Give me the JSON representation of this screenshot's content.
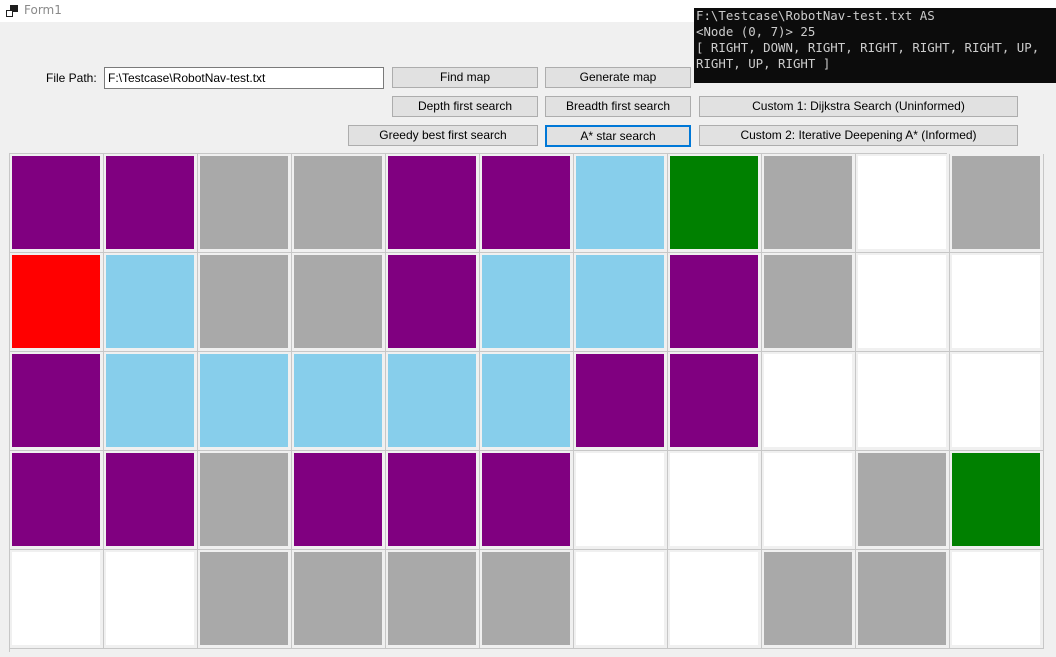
{
  "window": {
    "title": "Form1",
    "icon": "app-window-icon"
  },
  "form": {
    "file_path_label": "File Path:",
    "file_path_value": "F:\\Testcase\\RobotNav-test.txt"
  },
  "buttons": {
    "find_map": "Find map",
    "generate_map": "Generate map",
    "depth_first": "Depth first search",
    "breadth_first": "Breadth first search",
    "custom1": "Custom 1: Dijkstra Search (Uninformed)",
    "greedy": "Greedy best first search",
    "astar": "A* star search",
    "custom2": "Custom 2: Iterative Deepening A* (Informed)"
  },
  "console": {
    "lines": [
      "F:\\Testcase\\RobotNav-test.txt AS",
      "<Node (0, 7)> 25",
      "[ RIGHT, DOWN, RIGHT, RIGHT, RIGHT, RIGHT, UP,",
      "RIGHT, UP, RIGHT ]"
    ]
  },
  "colors": {
    "P": "#800080",
    "G": "#a9a9a9",
    "B": "#87ceeb",
    "R": "#ff0000",
    "E": "#008000",
    "W": "#ffffff"
  },
  "legend_semantics": {
    "P": "explored",
    "G": "wall",
    "B": "path",
    "R": "start",
    "E": "goal",
    "W": "empty"
  },
  "grid": {
    "rows": [
      [
        "P",
        "P",
        "G",
        "G",
        "P",
        "P",
        "B",
        "E",
        "G",
        "W",
        "G"
      ],
      [
        "R",
        "B",
        "G",
        "G",
        "P",
        "B",
        "B",
        "P",
        "G",
        "W",
        "W"
      ],
      [
        "P",
        "B",
        "B",
        "B",
        "B",
        "B",
        "P",
        "P",
        "W",
        "W",
        "W"
      ],
      [
        "P",
        "P",
        "G",
        "P",
        "P",
        "P",
        "W",
        "W",
        "W",
        "G",
        "E"
      ],
      [
        "W",
        "W",
        "G",
        "G",
        "G",
        "G",
        "W",
        "W",
        "G",
        "G",
        "W"
      ]
    ]
  }
}
